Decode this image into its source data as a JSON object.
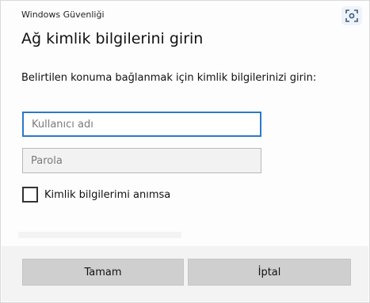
{
  "window": {
    "title": "Windows Güvenliği",
    "corner_icon": "screen-capture-icon"
  },
  "dialog": {
    "heading": "Ağ kimlik bilgilerini girin",
    "instruction": "Belirtilen konuma bağlanmak için kimlik bilgilerinizi girin:"
  },
  "form": {
    "username": {
      "value": "",
      "placeholder": "Kullanıcı adı"
    },
    "password": {
      "value": "",
      "placeholder": "Parola"
    },
    "remember": {
      "label": "Kimlik bilgilerimi anımsa",
      "checked": false
    }
  },
  "buttons": {
    "ok_label": "Tamam",
    "cancel_label": "İptal"
  },
  "colors": {
    "focus_border": "#2b79c9",
    "button_bg": "#cfcfcf",
    "footer_bg": "#f3f3f3"
  }
}
